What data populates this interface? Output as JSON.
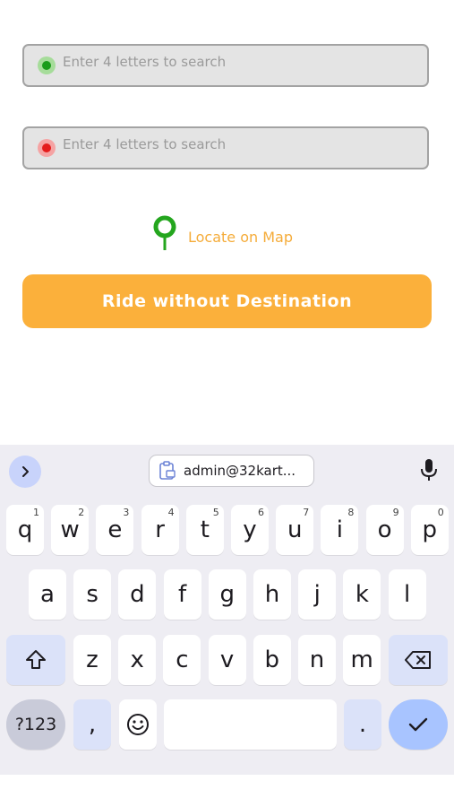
{
  "pickup": {
    "placeholder": "Enter 4 letters to search",
    "dot_color": "#1a9c1a",
    "ring_color": "#a6dc9a"
  },
  "dropoff": {
    "placeholder": "Enter 4 letters to search",
    "dot_color": "#e41b1b",
    "ring_color": "#f5a3a3"
  },
  "locate": {
    "label": "Locate on Map",
    "icon": "map-pin-icon",
    "pin_color": "#24a61e",
    "text_color": "#f5ac3a"
  },
  "ride_button": {
    "label": "Ride without Destination",
    "color": "#fbb03b"
  },
  "keyboard": {
    "clipboard_text": "admin@32kart...",
    "row1": [
      {
        "k": "q",
        "h": "1"
      },
      {
        "k": "w",
        "h": "2"
      },
      {
        "k": "e",
        "h": "3"
      },
      {
        "k": "r",
        "h": "4"
      },
      {
        "k": "t",
        "h": "5"
      },
      {
        "k": "y",
        "h": "6"
      },
      {
        "k": "u",
        "h": "7"
      },
      {
        "k": "i",
        "h": "8"
      },
      {
        "k": "o",
        "h": "9"
      },
      {
        "k": "p",
        "h": "0"
      }
    ],
    "row2": [
      "a",
      "s",
      "d",
      "f",
      "g",
      "h",
      "j",
      "k",
      "l"
    ],
    "row3": [
      "z",
      "x",
      "c",
      "v",
      "b",
      "n",
      "m"
    ],
    "symbols_label": "?123",
    "comma": ",",
    "period": "."
  }
}
